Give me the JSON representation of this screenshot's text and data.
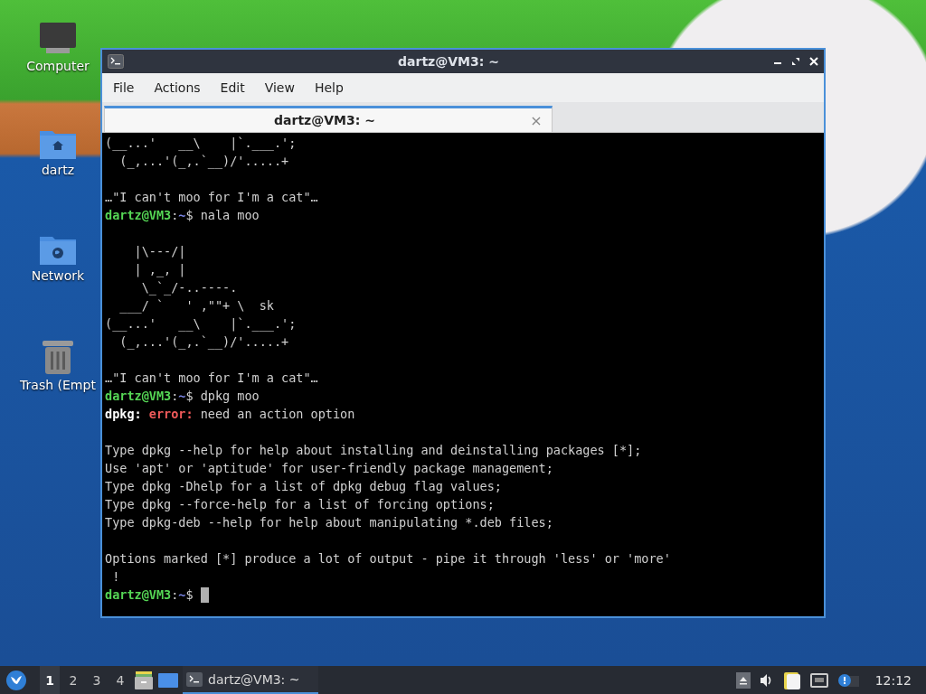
{
  "desktop_icons": [
    {
      "label": "Computer",
      "kind": "computer"
    },
    {
      "label": "dartz",
      "kind": "home"
    },
    {
      "label": "Network",
      "kind": "network"
    },
    {
      "label": "Trash (Empt",
      "kind": "trash"
    }
  ],
  "window": {
    "title": "dartz@VM3: ~",
    "menu": [
      "File",
      "Actions",
      "Edit",
      "View",
      "Help"
    ],
    "tabs": [
      {
        "label": "dartz@VM3: ~",
        "selected": true,
        "close": "×"
      }
    ],
    "terminal": {
      "lines": [
        {
          "kind": "text",
          "segments": [
            {
              "kind": "plain",
              "text": "(__...'   __\\    |`.___.';"
            }
          ]
        },
        {
          "kind": "text",
          "segments": [
            {
              "kind": "plain",
              "text": "  (_,...'(_,.`__)/'.....+"
            }
          ]
        },
        {
          "kind": "blank"
        },
        {
          "kind": "text",
          "segments": [
            {
              "kind": "plain",
              "text": "…\"I can't moo for I'm a cat\"…"
            }
          ]
        },
        {
          "kind": "text",
          "segments": [
            {
              "kind": "user",
              "text": "dartz@VM3"
            },
            {
              "kind": "plain",
              "text": ":"
            },
            {
              "kind": "path",
              "text": "~"
            },
            {
              "kind": "plain",
              "text": "$ nala moo"
            }
          ]
        },
        {
          "kind": "blank"
        },
        {
          "kind": "text",
          "segments": [
            {
              "kind": "plain",
              "text": "    |\\---/|"
            }
          ]
        },
        {
          "kind": "text",
          "segments": [
            {
              "kind": "plain",
              "text": "    | ,_, |"
            }
          ]
        },
        {
          "kind": "text",
          "segments": [
            {
              "kind": "plain",
              "text": "     \\_`_/-..----."
            }
          ]
        },
        {
          "kind": "text",
          "segments": [
            {
              "kind": "plain",
              "text": "  ___/ `   ' ,\"\"+ \\  sk"
            }
          ]
        },
        {
          "kind": "text",
          "segments": [
            {
              "kind": "plain",
              "text": "(__...'   __\\    |`.___.';"
            }
          ]
        },
        {
          "kind": "text",
          "segments": [
            {
              "kind": "plain",
              "text": "  (_,...'(_,.`__)/'.....+"
            }
          ]
        },
        {
          "kind": "blank"
        },
        {
          "kind": "text",
          "segments": [
            {
              "kind": "plain",
              "text": "…\"I can't moo for I'm a cat\"…"
            }
          ]
        },
        {
          "kind": "text",
          "segments": [
            {
              "kind": "user",
              "text": "dartz@VM3"
            },
            {
              "kind": "plain",
              "text": ":"
            },
            {
              "kind": "path",
              "text": "~"
            },
            {
              "kind": "plain",
              "text": "$ dpkg moo"
            }
          ]
        },
        {
          "kind": "text",
          "segments": [
            {
              "kind": "bold",
              "text": "dpkg:"
            },
            {
              "kind": "error",
              "text": "error:"
            },
            {
              "kind": "plain",
              "text": " need an action option"
            }
          ]
        },
        {
          "kind": "blank"
        },
        {
          "kind": "text",
          "segments": [
            {
              "kind": "plain",
              "text": "Type dpkg --help for help about installing and deinstalling packages [*];"
            }
          ]
        },
        {
          "kind": "text",
          "segments": [
            {
              "kind": "plain",
              "text": "Use 'apt' or 'aptitude' for user-friendly package management;"
            }
          ]
        },
        {
          "kind": "text",
          "segments": [
            {
              "kind": "plain",
              "text": "Type dpkg -Dhelp for a list of dpkg debug flag values;"
            }
          ]
        },
        {
          "kind": "text",
          "segments": [
            {
              "kind": "plain",
              "text": "Type dpkg --force-help for a list of forcing options;"
            }
          ]
        },
        {
          "kind": "text",
          "segments": [
            {
              "kind": "plain",
              "text": "Type dpkg-deb --help for help about manipulating *.deb files;"
            }
          ]
        },
        {
          "kind": "blank"
        },
        {
          "kind": "text",
          "segments": [
            {
              "kind": "plain",
              "text": "Options marked [*] produce a lot of output - pipe it through 'less' or 'more'"
            }
          ]
        },
        {
          "kind": "text",
          "segments": [
            {
              "kind": "plain",
              "text": " !"
            }
          ]
        },
        {
          "kind": "text",
          "cursor": true,
          "segments": [
            {
              "kind": "user",
              "text": "dartz@VM3"
            },
            {
              "kind": "plain",
              "text": ":"
            },
            {
              "kind": "path",
              "text": "~"
            },
            {
              "kind": "plain",
              "text": "$ "
            }
          ]
        }
      ]
    }
  },
  "taskbar": {
    "workspaces": [
      {
        "label": "1",
        "selected": true
      },
      {
        "label": "2",
        "selected": false
      },
      {
        "label": "3",
        "selected": false
      },
      {
        "label": "4",
        "selected": false
      }
    ],
    "tasks": [
      {
        "label": "dartz@VM3: ~",
        "selected": true
      }
    ],
    "clock": "12:12"
  }
}
